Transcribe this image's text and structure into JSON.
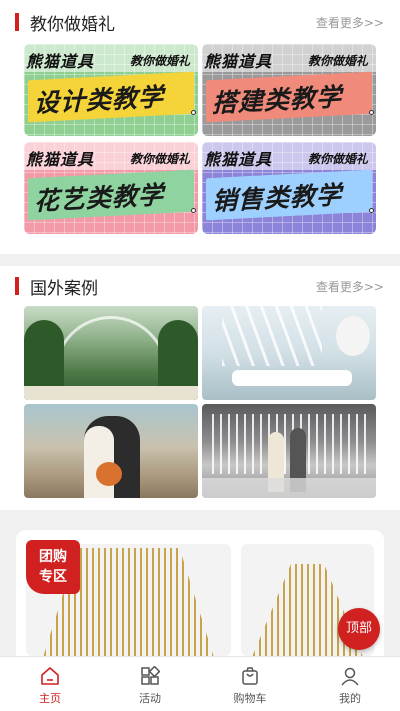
{
  "section_tutorial": {
    "title": "教你做婚礼",
    "more": "查看更多>>",
    "banners": [
      {
        "brand": "熊猫道具",
        "sub": "教你做婚礼",
        "main": "设计类教学"
      },
      {
        "brand": "熊猫道具",
        "sub": "教你做婚礼",
        "main": "搭建类教学"
      },
      {
        "brand": "熊猫道具",
        "sub": "教你做婚礼",
        "main": "花艺类教学"
      },
      {
        "brand": "熊猫道具",
        "sub": "教你做婚礼",
        "main": "销售类教学"
      }
    ]
  },
  "section_cases": {
    "title": "国外案例",
    "more": "查看更多>>"
  },
  "group_buy": {
    "badge_line1": "团购",
    "badge_line2": "专区"
  },
  "top_button": "顶部",
  "tabbar": {
    "items": [
      {
        "label": "主页",
        "icon": "home-icon",
        "active": true
      },
      {
        "label": "活动",
        "icon": "grid-icon",
        "active": false
      },
      {
        "label": "购物车",
        "icon": "cart-icon",
        "active": false
      },
      {
        "label": "我的",
        "icon": "user-icon",
        "active": false
      }
    ]
  },
  "colors": {
    "accent": "#d0201f"
  }
}
